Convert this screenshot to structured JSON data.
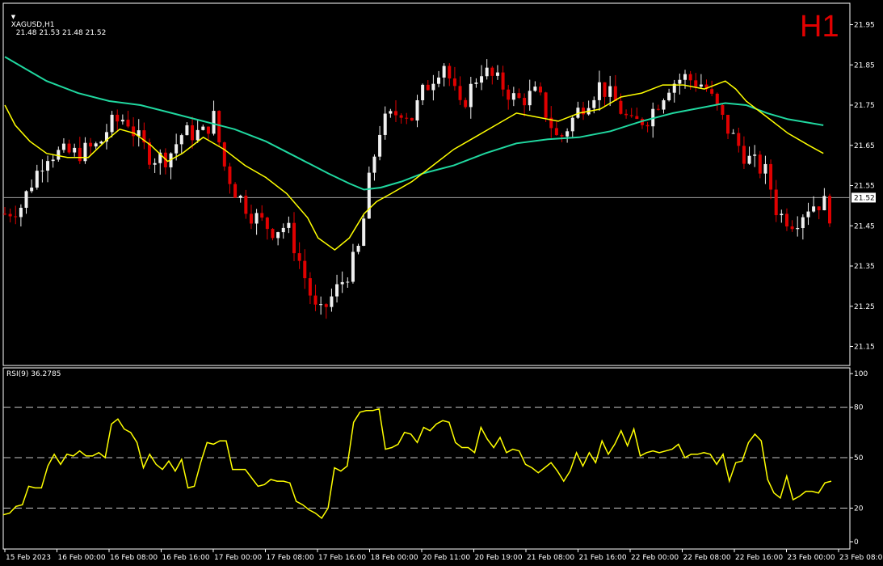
{
  "header": {
    "symbol": "XAGUSD,H1",
    "ohlc": "21.48 21.53 21.48 21.52",
    "timeframe_label": "H1"
  },
  "rsi_header": {
    "label": "RSI(9) 36.2785"
  },
  "current_price_label": "21.52",
  "colors": {
    "background": "#000000",
    "bull": "#f0f0f0",
    "bear": "#e00000",
    "ma_fast": "#ffff00",
    "ma_slow": "#20d8a0",
    "rsi": "#ffff00",
    "grid_text": "#ffffff",
    "price_line": "#a0a0a0"
  },
  "chart_data": [
    {
      "type": "candlestick",
      "title": "XAGUSD,H1",
      "ylim": [
        21.12,
        22.02
      ],
      "yticks": [
        "21.95",
        "21.85",
        "21.75",
        "21.65",
        "21.55",
        "21.45",
        "21.35",
        "21.25",
        "21.15"
      ],
      "ytick_values": [
        21.95,
        21.85,
        21.75,
        21.65,
        21.55,
        21.45,
        21.35,
        21.25,
        21.15
      ],
      "current_price": 21.52,
      "bar_count": 155,
      "xtick_labels": [
        "15 Feb 2023",
        "16 Feb 00:00",
        "16 Feb 08:00",
        "16 Feb 16:00",
        "17 Feb 00:00",
        "17 Feb 08:00",
        "17 Feb 16:00",
        "18 Feb 00:00",
        "20 Feb 11:00",
        "20 Feb 19:00",
        "21 Feb 08:00",
        "21 Feb 16:00",
        "22 Feb 00:00",
        "22 Feb 08:00",
        "22 Feb 16:00",
        "23 Feb 00:00",
        "23 Feb 08:00"
      ],
      "xtick_bar_index": [
        0,
        10,
        20,
        30,
        40,
        50,
        60,
        70,
        80,
        90,
        100,
        110,
        120,
        130,
        140,
        150,
        158
      ],
      "close_path": [
        [
          0,
          21.48
        ],
        [
          8,
          21.5
        ],
        [
          12,
          21.55
        ],
        [
          20,
          21.63
        ],
        [
          35,
          21.63
        ],
        [
          45,
          21.65
        ],
        [
          50,
          21.7
        ],
        [
          58,
          21.72
        ],
        [
          62,
          21.68
        ],
        [
          70,
          21.62
        ],
        [
          78,
          21.62
        ],
        [
          85,
          21.68
        ],
        [
          95,
          21.68
        ],
        [
          100,
          21.72
        ],
        [
          105,
          21.6
        ],
        [
          110,
          21.54
        ],
        [
          118,
          21.48
        ],
        [
          128,
          21.44
        ],
        [
          135,
          21.45
        ],
        [
          140,
          21.38
        ],
        [
          145,
          21.3
        ],
        [
          150,
          21.22
        ],
        [
          155,
          21.26
        ],
        [
          160,
          21.3
        ],
        [
          165,
          21.34
        ],
        [
          170,
          21.4
        ],
        [
          175,
          21.58
        ],
        [
          180,
          21.7
        ],
        [
          190,
          21.74
        ],
        [
          195,
          21.72
        ],
        [
          200,
          21.78
        ],
        [
          210,
          21.86
        ],
        [
          218,
          21.74
        ],
        [
          228,
          21.84
        ],
        [
          238,
          21.8
        ],
        [
          245,
          21.76
        ],
        [
          255,
          21.78
        ],
        [
          265,
          21.66
        ],
        [
          275,
          21.74
        ],
        [
          285,
          21.8
        ],
        [
          292,
          21.76
        ],
        [
          300,
          21.7
        ],
        [
          308,
          21.72
        ],
        [
          318,
          21.8
        ],
        [
          325,
          21.82
        ],
        [
          335,
          21.8
        ],
        [
          345,
          21.7
        ],
        [
          355,
          21.62
        ],
        [
          365,
          21.58
        ],
        [
          370,
          21.48
        ],
        [
          378,
          21.46
        ],
        [
          385,
          21.5
        ],
        [
          392,
          21.51
        ],
        [
          395,
          21.48
        ]
      ],
      "ma_fast_path": [
        [
          0,
          21.75
        ],
        [
          5,
          21.7
        ],
        [
          12,
          21.66
        ],
        [
          20,
          21.63
        ],
        [
          30,
          21.62
        ],
        [
          40,
          21.62
        ],
        [
          48,
          21.66
        ],
        [
          55,
          21.69
        ],
        [
          62,
          21.68
        ],
        [
          70,
          21.65
        ],
        [
          78,
          21.61
        ],
        [
          85,
          21.63
        ],
        [
          95,
          21.67
        ],
        [
          105,
          21.64
        ],
        [
          115,
          21.6
        ],
        [
          125,
          21.57
        ],
        [
          135,
          21.53
        ],
        [
          145,
          21.47
        ],
        [
          150,
          21.42
        ],
        [
          158,
          21.39
        ],
        [
          165,
          21.42
        ],
        [
          172,
          21.48
        ],
        [
          178,
          21.51
        ],
        [
          185,
          21.53
        ],
        [
          195,
          21.56
        ],
        [
          205,
          21.6
        ],
        [
          215,
          21.64
        ],
        [
          225,
          21.67
        ],
        [
          235,
          21.7
        ],
        [
          245,
          21.73
        ],
        [
          255,
          21.72
        ],
        [
          265,
          21.71
        ],
        [
          275,
          21.73
        ],
        [
          285,
          21.74
        ],
        [
          295,
          21.77
        ],
        [
          305,
          21.78
        ],
        [
          315,
          21.8
        ],
        [
          325,
          21.8
        ],
        [
          335,
          21.79
        ],
        [
          345,
          21.81
        ],
        [
          350,
          21.79
        ],
        [
          355,
          21.76
        ],
        [
          365,
          21.72
        ],
        [
          375,
          21.68
        ],
        [
          385,
          21.65
        ],
        [
          392,
          21.63
        ]
      ],
      "ma_slow_path": [
        [
          0,
          21.87
        ],
        [
          10,
          21.84
        ],
        [
          20,
          21.81
        ],
        [
          35,
          21.78
        ],
        [
          50,
          21.76
        ],
        [
          65,
          21.75
        ],
        [
          80,
          21.73
        ],
        [
          95,
          21.71
        ],
        [
          110,
          21.69
        ],
        [
          125,
          21.66
        ],
        [
          140,
          21.62
        ],
        [
          155,
          21.58
        ],
        [
          165,
          21.555
        ],
        [
          172,
          21.54
        ],
        [
          180,
          21.545
        ],
        [
          190,
          21.56
        ],
        [
          200,
          21.58
        ],
        [
          215,
          21.6
        ],
        [
          230,
          21.63
        ],
        [
          245,
          21.655
        ],
        [
          260,
          21.665
        ],
        [
          275,
          21.67
        ],
        [
          290,
          21.685
        ],
        [
          305,
          21.71
        ],
        [
          320,
          21.73
        ],
        [
          335,
          21.745
        ],
        [
          345,
          21.755
        ],
        [
          355,
          21.75
        ],
        [
          365,
          21.73
        ],
        [
          375,
          21.715
        ],
        [
          392,
          21.7
        ]
      ]
    },
    {
      "type": "line",
      "title": "RSI(9) 36.2785",
      "ylim": [
        0,
        100
      ],
      "yticks": [
        "100",
        "80",
        "50",
        "20",
        "0"
      ],
      "ytick_values": [
        100,
        80,
        50,
        20,
        0
      ],
      "levels": [
        80,
        50,
        20
      ],
      "current_value": 36.2785,
      "rsi_path": [
        [
          0,
          16
        ],
        [
          3,
          17
        ],
        [
          6,
          21
        ],
        [
          9,
          22
        ],
        [
          12,
          33
        ],
        [
          15,
          32
        ],
        [
          18,
          32
        ],
        [
          21,
          45
        ],
        [
          24,
          52
        ],
        [
          27,
          46
        ],
        [
          30,
          52
        ],
        [
          33,
          51
        ],
        [
          36,
          54
        ],
        [
          39,
          51
        ],
        [
          42,
          51
        ],
        [
          45,
          53
        ],
        [
          48,
          50
        ],
        [
          51,
          70
        ],
        [
          54,
          73
        ],
        [
          57,
          67
        ],
        [
          60,
          65
        ],
        [
          63,
          59
        ],
        [
          66,
          44
        ],
        [
          69,
          52
        ],
        [
          72,
          46
        ],
        [
          75,
          43
        ],
        [
          78,
          48
        ],
        [
          81,
          42
        ],
        [
          84,
          49
        ],
        [
          87,
          32
        ],
        [
          90,
          33
        ],
        [
          93,
          47
        ],
        [
          96,
          59
        ],
        [
          99,
          58
        ],
        [
          102,
          60
        ],
        [
          105,
          60
        ],
        [
          108,
          43
        ],
        [
          111,
          43
        ],
        [
          114,
          43
        ],
        [
          117,
          38
        ],
        [
          120,
          33
        ],
        [
          123,
          34
        ],
        [
          126,
          37
        ],
        [
          129,
          36
        ],
        [
          132,
          36
        ],
        [
          135,
          35
        ],
        [
          138,
          24
        ],
        [
          141,
          22
        ],
        [
          144,
          19
        ],
        [
          147,
          17
        ],
        [
          150,
          14
        ],
        [
          153,
          20
        ],
        [
          156,
          44
        ],
        [
          159,
          42
        ],
        [
          162,
          45
        ],
        [
          165,
          71
        ],
        [
          168,
          77
        ],
        [
          171,
          78
        ],
        [
          174,
          78
        ],
        [
          177,
          79
        ],
        [
          180,
          55
        ],
        [
          183,
          56
        ],
        [
          186,
          58
        ],
        [
          189,
          65
        ],
        [
          192,
          64
        ],
        [
          195,
          59
        ],
        [
          198,
          68
        ],
        [
          201,
          66
        ],
        [
          204,
          70
        ],
        [
          207,
          72
        ],
        [
          210,
          71
        ],
        [
          213,
          59
        ],
        [
          216,
          56
        ],
        [
          219,
          56
        ],
        [
          222,
          53
        ],
        [
          225,
          68
        ],
        [
          228,
          61
        ],
        [
          231,
          56
        ],
        [
          234,
          62
        ],
        [
          237,
          53
        ],
        [
          240,
          55
        ],
        [
          243,
          54
        ],
        [
          246,
          46
        ],
        [
          249,
          44
        ],
        [
          252,
          41
        ],
        [
          255,
          44
        ],
        [
          258,
          47
        ],
        [
          261,
          42
        ],
        [
          264,
          36
        ],
        [
          267,
          42
        ],
        [
          270,
          53
        ],
        [
          273,
          45
        ],
        [
          276,
          53
        ],
        [
          279,
          47
        ],
        [
          282,
          60
        ],
        [
          285,
          52
        ],
        [
          288,
          58
        ],
        [
          291,
          66
        ],
        [
          294,
          57
        ],
        [
          297,
          67
        ],
        [
          300,
          51
        ],
        [
          303,
          53
        ],
        [
          306,
          54
        ],
        [
          309,
          53
        ],
        [
          312,
          54
        ],
        [
          315,
          55
        ],
        [
          318,
          58
        ],
        [
          321,
          50
        ],
        [
          324,
          52
        ],
        [
          327,
          52
        ],
        [
          330,
          53
        ],
        [
          333,
          52
        ],
        [
          336,
          46
        ],
        [
          339,
          52
        ],
        [
          342,
          36
        ],
        [
          345,
          47
        ],
        [
          348,
          48
        ],
        [
          351,
          59
        ],
        [
          354,
          64
        ],
        [
          357,
          60
        ],
        [
          360,
          37
        ],
        [
          363,
          29
        ],
        [
          366,
          26
        ],
        [
          369,
          39
        ],
        [
          372,
          25
        ],
        [
          375,
          27
        ],
        [
          378,
          30
        ],
        [
          381,
          30
        ],
        [
          384,
          29
        ],
        [
          387,
          35
        ],
        [
          390,
          36
        ]
      ]
    }
  ]
}
